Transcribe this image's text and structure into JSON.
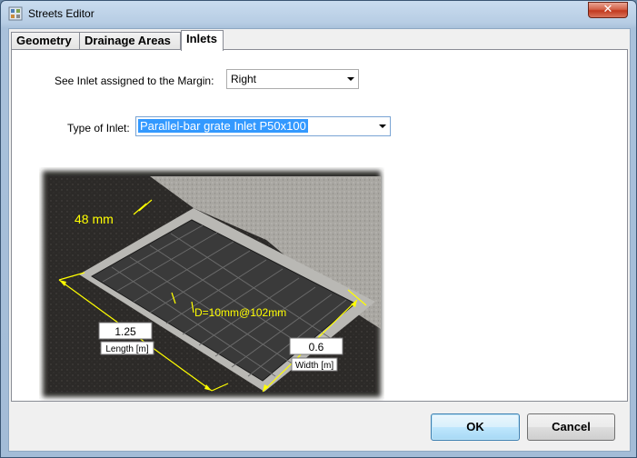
{
  "window": {
    "title": "Streets Editor",
    "close_symbol": "✕"
  },
  "tabs": [
    {
      "label": "Geometry",
      "active": false
    },
    {
      "label": "Drainage Areas",
      "active": false
    },
    {
      "label": "Inlets",
      "active": true
    }
  ],
  "inlets": {
    "margin_label": "See Inlet assigned to the Margin:",
    "margin_value": "Right",
    "type_label": "Type of Inlet:",
    "type_value": "Parallel-bar grate Inlet P50x100"
  },
  "illustration": {
    "bar_thickness": "48 mm",
    "bar_spacing": "D=10mm@102mm",
    "length_value": "1.25",
    "length_label": "Length [m]",
    "width_value": "0.6",
    "width_label": "Width [m]"
  },
  "buttons": {
    "ok": "OK",
    "cancel": "Cancel"
  },
  "colors": {
    "dimension": "#ffff00",
    "accent": "#3399ff"
  }
}
